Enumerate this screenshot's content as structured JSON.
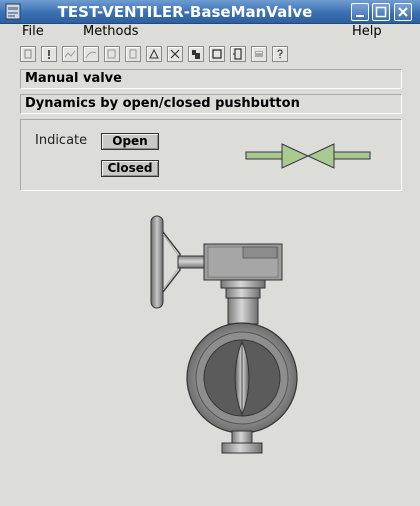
{
  "window": {
    "title": "TEST-VENTILER-BaseManValve"
  },
  "menu": {
    "file": "File",
    "methods": "Methods",
    "help": "Help"
  },
  "toolbar": {
    "icons": [
      "graph-icon",
      "event-icon",
      "trend-icon",
      "fast-curve-icon",
      "object-icon",
      "open-object-icon",
      "crossref-icon",
      "help-class-icon",
      "datasheet-icon",
      "rtnavigator-icon",
      "circuit-icon",
      "note-icon",
      "help-icon"
    ]
  },
  "header": {
    "line1": "Manual valve",
    "line2": "Dynamics by open/closed pushbutton"
  },
  "panel": {
    "indicate_label": "Indicate",
    "open_label": "Open",
    "closed_label": "Closed"
  },
  "colors": {
    "titlebar": "#3b70b3",
    "background": "#dcdcd8",
    "valve_symbol_fill": "#a9c98e",
    "valve_body": "#8c8c8c"
  }
}
